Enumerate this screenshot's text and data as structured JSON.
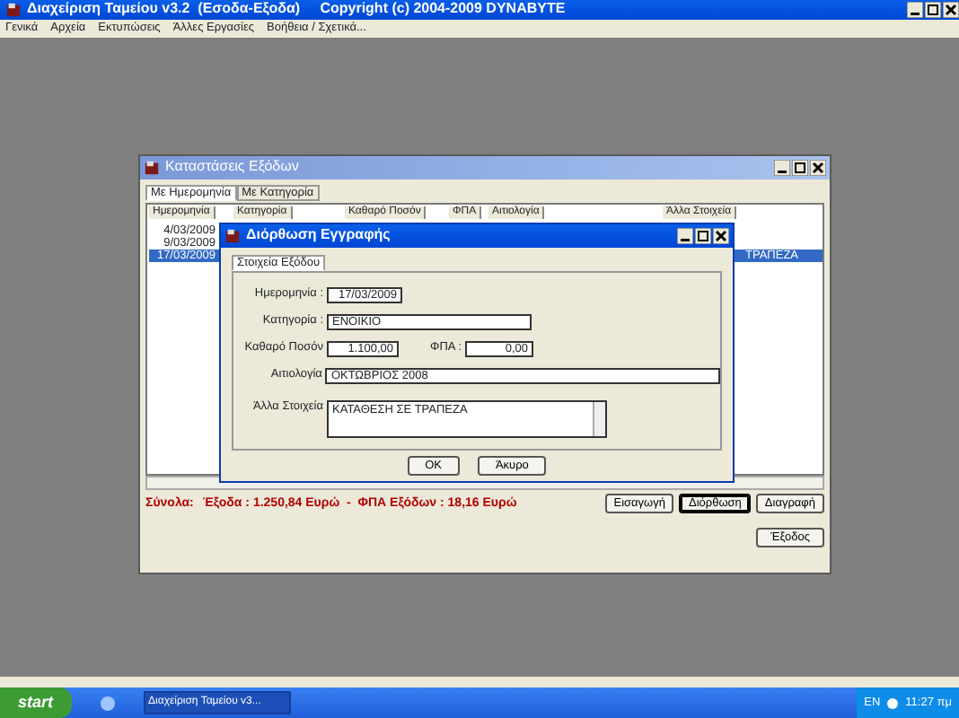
{
  "app": {
    "title": "Διαχείριση Ταμείου v3.2  (Εσοδα-Εξοδα)     Copyright (c) 2004-2009 DYNABYTE",
    "menu": [
      "Γενικά",
      "Αρχεία",
      "Εκτυπώσεις",
      "Άλλες Εργασίες",
      "Βοήθεια / Σχετικά..."
    ]
  },
  "report_window": {
    "title": "Καταστάσεις Εξόδων",
    "tabs": [
      {
        "label": "Με Ημερομηνία",
        "selected": true
      },
      {
        "label": "Με Κατηγορία",
        "selected": false
      }
    ],
    "columns": [
      "Ημερομηνία",
      "Κατηγορία",
      "Καθαρό Ποσόν",
      "ΦΠΑ",
      "Αιτιολογία",
      "Άλλα Στοιχεία"
    ],
    "rows": [
      {
        "date": "4/03/2009",
        "selected": false
      },
      {
        "date": "9/03/2009",
        "selected": false
      },
      {
        "date": "17/03/2009",
        "other": "ΤΡΑΠΕΖΑ",
        "selected": true
      }
    ],
    "totals_label": "Σύνολα:",
    "totals": "Έξοδα : 1.250,84 Ευρώ  -  ΦΠΑ Εξόδων : 18,16 Ευρώ",
    "buttons": [
      {
        "label": "Εισαγωγή",
        "focused": false
      },
      {
        "label": "Διόρθωση",
        "focused": true
      },
      {
        "label": "Διαγραφή",
        "focused": false
      }
    ],
    "exit_button": "Έξοδος"
  },
  "edit_dialog": {
    "title": "Διόρθωση Εγγραφής",
    "tab": "Στοιχεία Εξόδου",
    "fields": [
      {
        "kind": "short",
        "label": "Ημερομηνία :",
        "value": "17/03/2009"
      },
      {
        "kind": "medium",
        "label": "Κατηγορία :",
        "value": "ΕΝΟΙΚΙΟ"
      },
      {
        "kind": "pair",
        "label": "Καθαρό Ποσόν",
        "value": "1.100,00",
        "label2": "ΦΠΑ :",
        "value2": "0,00"
      },
      {
        "kind": "long",
        "label": "Αιτιολογία",
        "value": "ΟΚΤΩΒΡΙΟΣ 2008"
      },
      {
        "kind": "memo",
        "label": "Άλλα Στοιχεία",
        "value": "ΚΑΤΑΘΕΣΗ ΣΕ ΤΡΑΠΕΖΑ"
      }
    ],
    "buttons": [
      "ΟΚ",
      "Άκυρο"
    ]
  },
  "taskbar": {
    "start": "start",
    "task": "Διαχείριση Ταμείου v3...",
    "lang": "EN",
    "clock": "11:27 πμ"
  }
}
